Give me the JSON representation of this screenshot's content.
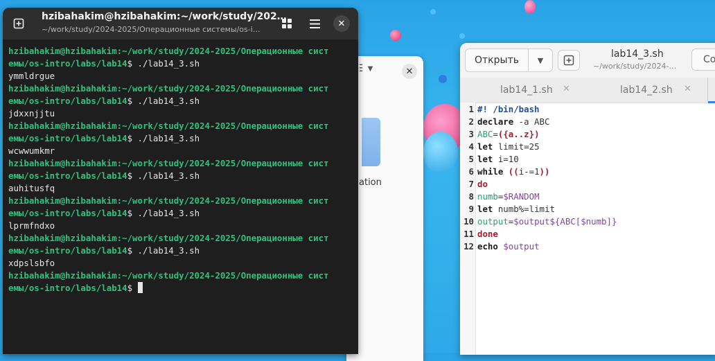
{
  "terminal": {
    "title": "hzibahakim@hzibahakim:~/work/study/202…",
    "subtitle": "~/work/study/2024-2025/Операционные системы/os-i…",
    "prompt_line1": "hzibahakim@hzibahakim:~/work/study/2024-2025/Операционные сист",
    "prompt_line2_path": "емы/os-intro/labs/lab14",
    "prompt_symbol": "$",
    "command": " ./lab14_3.sh",
    "outputs": [
      "ymmldrgue",
      "jdxxnjjtu",
      "wcwwumkmr",
      "auhitusfq",
      "lprmfndxo",
      "xdpslsbfo"
    ]
  },
  "file_manager": {
    "partial_label": "ation"
  },
  "editor": {
    "open_label": "Открыть",
    "title": "lab14_3.sh",
    "subtitle": "~/work/study/2024-…",
    "save_partial": "Co",
    "tabs": [
      {
        "label": "lab14_1.sh"
      },
      {
        "label": "lab14_2.sh"
      }
    ],
    "line_numbers": [
      "1",
      "2",
      "3",
      "4",
      "5",
      "6",
      "7",
      "8",
      "9",
      "10",
      "11",
      "12"
    ],
    "code": {
      "l1": "#! /bin/bash",
      "l2a": "declare",
      "l2b": " -a ABC",
      "l3a": "ABC",
      "l3b": "=",
      "l3c": "({a..z})",
      "l4a": "let",
      "l4b": " limit=25",
      "l5a": "let",
      "l5b": " i=10",
      "l6a": "while",
      "l6b": " ((",
      "l6c": "i-=1",
      "l6d": "))",
      "l7": "do",
      "l8a": "numb",
      "l8b": "=",
      "l8c": "$RANDOM",
      "l9a": "let",
      "l9b": " numb%=limit",
      "l10a": "output",
      "l10b": "=",
      "l10c": "$output${ABC[",
      "l10d": "$numb",
      "l10e": "]}",
      "l11": "done",
      "l12a": "echo",
      "l12b": " ",
      "l12c": "$output"
    }
  }
}
